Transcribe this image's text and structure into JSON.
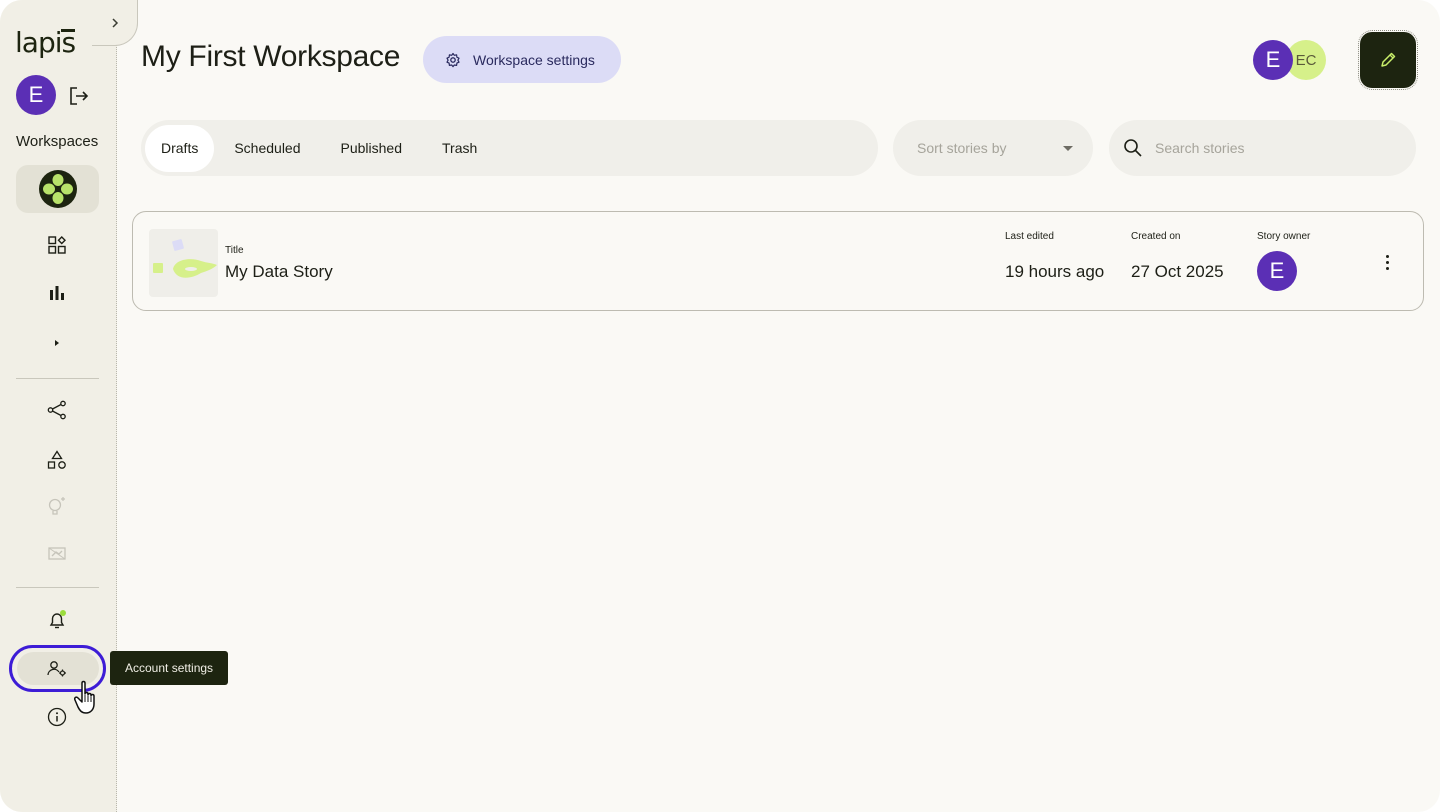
{
  "app": {
    "brand": "lapis"
  },
  "sidebar": {
    "user_initial": "E",
    "workspaces_label": "Workspaces",
    "tooltip": "Account settings",
    "icons": [
      "workspace-logo-icon",
      "apps-grid-icon",
      "bar-chart-icon",
      "caret-right-icon",
      "share-icon",
      "shapes-icon",
      "idea-icon",
      "presentation-icon",
      "bell-icon",
      "account-settings-icon",
      "info-icon"
    ]
  },
  "header": {
    "title": "My First Workspace",
    "settings_button": "Workspace settings",
    "collaborators": [
      "E",
      "EC"
    ]
  },
  "toolbar": {
    "tabs": [
      "Drafts",
      "Scheduled",
      "Published",
      "Trash"
    ],
    "active_tab": "Drafts",
    "sort_placeholder": "Sort stories by",
    "search_placeholder": "Search stories"
  },
  "stories": [
    {
      "title_label": "Title",
      "title": "My Data Story",
      "last_edited_label": "Last edited",
      "last_edited": "19 hours ago",
      "created_label": "Created on",
      "created": "27 Oct 2025",
      "owner_label": "Story owner",
      "owner_initial": "E"
    }
  ],
  "colors": {
    "accent": "#5b2fb5",
    "lime": "#d6f08a",
    "dark": "#1d2410",
    "highlight": "#3d1cd6"
  }
}
